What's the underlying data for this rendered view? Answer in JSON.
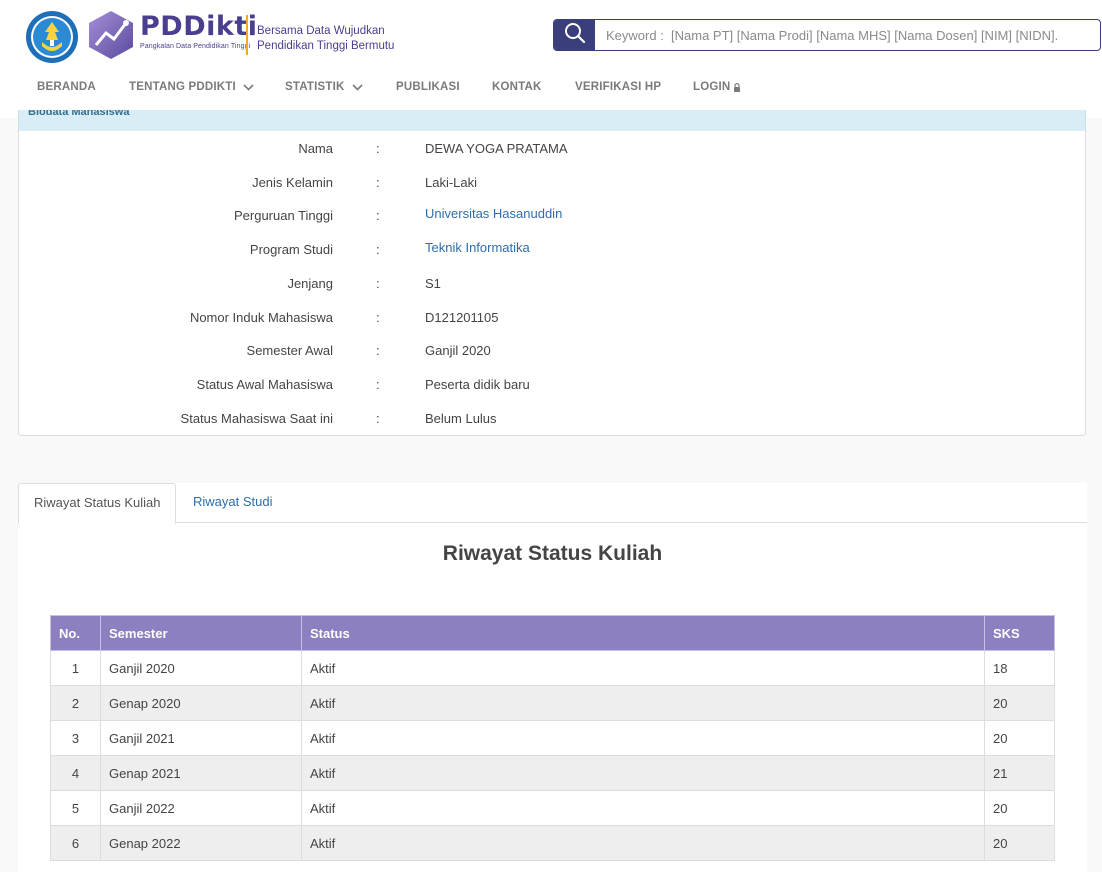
{
  "header": {
    "brand_name": "PDDikti",
    "brand_sub": "Pangkalan Data Pendidikan Tinggi",
    "tagline_line1": "Bersama Data Wujudkan",
    "tagline_line2": "Pendidikan Tinggi Bermutu",
    "logo_icon": "tut-wuri-handayani-logo",
    "brand_icon": "pddikti-logo"
  },
  "search": {
    "placeholder": "Keyword :  [Nama PT] [Nama Prodi] [Nama MHS] [Nama Dosen] [NIM] [NIDN].",
    "icon": "search-icon"
  },
  "nav": {
    "items": [
      {
        "label": "BERANDA"
      },
      {
        "label": "TENTANG PDDIKTI",
        "icon": "chevron-down-icon"
      },
      {
        "label": "STATISTIK",
        "icon": "chevron-down-icon"
      },
      {
        "label": "PUBLIKASI"
      },
      {
        "label": "KONTAK"
      },
      {
        "label": "VERIFIKASI HP"
      },
      {
        "label": "LOGIN",
        "icon": "lock-icon"
      }
    ]
  },
  "profile": {
    "heading": "Biodata Mahasiswa",
    "fields": [
      {
        "label": "Nama",
        "value": "DEWA YOGA PRATAMA"
      },
      {
        "label": "Jenis Kelamin",
        "value": "Laki-Laki"
      },
      {
        "label": "Perguruan Tinggi",
        "value": "Universitas Hasanuddin"
      },
      {
        "label": "Program Studi",
        "value": "Teknik Informatika"
      },
      {
        "label": "Jenjang",
        "value": "S1"
      },
      {
        "label": "Nomor Induk Mahasiswa",
        "value": "D121201105"
      },
      {
        "label": "Semester Awal",
        "value": "Ganjil 2020"
      },
      {
        "label": "Status Awal Mahasiswa",
        "value": "Peserta didik baru"
      },
      {
        "label": "Status Mahasiswa Saat ini",
        "value": "Belum Lulus"
      }
    ],
    "colon": ":"
  },
  "tabs": [
    {
      "label": "Riwayat Status Kuliah",
      "active": true
    },
    {
      "label": "Riwayat Studi",
      "active": false
    }
  ],
  "status_section": {
    "title": "Riwayat Status Kuliah",
    "columns": [
      "No.",
      "Semester",
      "Status",
      "SKS"
    ],
    "rows": [
      {
        "no": "1",
        "semester": "Ganjil 2020",
        "status": "Aktif",
        "sks": "18"
      },
      {
        "no": "2",
        "semester": "Genap 2020",
        "status": "Aktif",
        "sks": "20"
      },
      {
        "no": "3",
        "semester": "Ganjil 2021",
        "status": "Aktif",
        "sks": "20"
      },
      {
        "no": "4",
        "semester": "Genap 2021",
        "status": "Aktif",
        "sks": "21"
      },
      {
        "no": "5",
        "semester": "Ganjil 2022",
        "status": "Aktif",
        "sks": "20"
      },
      {
        "no": "6",
        "semester": "Genap 2022",
        "status": "Aktif",
        "sks": "20"
      }
    ]
  },
  "colors": {
    "brand": "#4a3f8f",
    "search_border": "#3a3f7c",
    "table_header": "#8d7fc0",
    "link": "#2f6eaa",
    "panel_heading": "#d9edf7"
  }
}
